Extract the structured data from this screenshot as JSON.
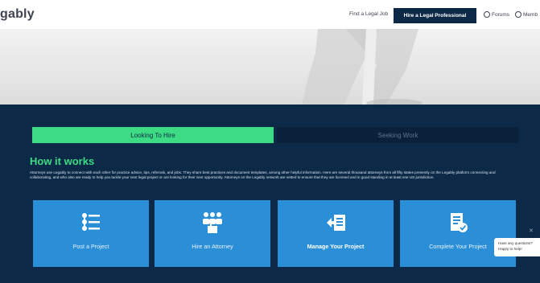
{
  "header": {
    "logo": "gably",
    "find_job": "Find a Legal Job",
    "hire_pro": "Hire a Legal Professional",
    "forums": "Forums",
    "members": "Memb"
  },
  "tabs": {
    "hire": "Looking To Hire",
    "seek": "Seeking Work"
  },
  "how": {
    "title": "How it works",
    "description": "Attorneys use Legably to connect with each other for practice advice, tips, referrals, and jobs. They share best practices and document templates, among other helpful information. Here are several thousand attorneys from all fifty states presently on the Legably platform connecting and collaborating, and who also are ready to help you tackle your next legal project or are looking for their next opportunity. Attorneys on the Legably network are vetted to ensure that they are licensed and in good standing in at least one US jurisdiction."
  },
  "cards": [
    {
      "label": "Post a Project",
      "icon": "list-icon"
    },
    {
      "label": "Hire an Attorney",
      "icon": "people-icon"
    },
    {
      "label": "Manage Your Project",
      "icon": "manage-icon"
    },
    {
      "label": "Complete Your Project",
      "icon": "document-check-icon"
    }
  ],
  "chat": {
    "line1": "Have any questions?",
    "line2": "Happy to help!"
  },
  "colors": {
    "navy": "#0c2a47",
    "green": "#3ddc84",
    "card_blue": "#2a8fd6"
  }
}
